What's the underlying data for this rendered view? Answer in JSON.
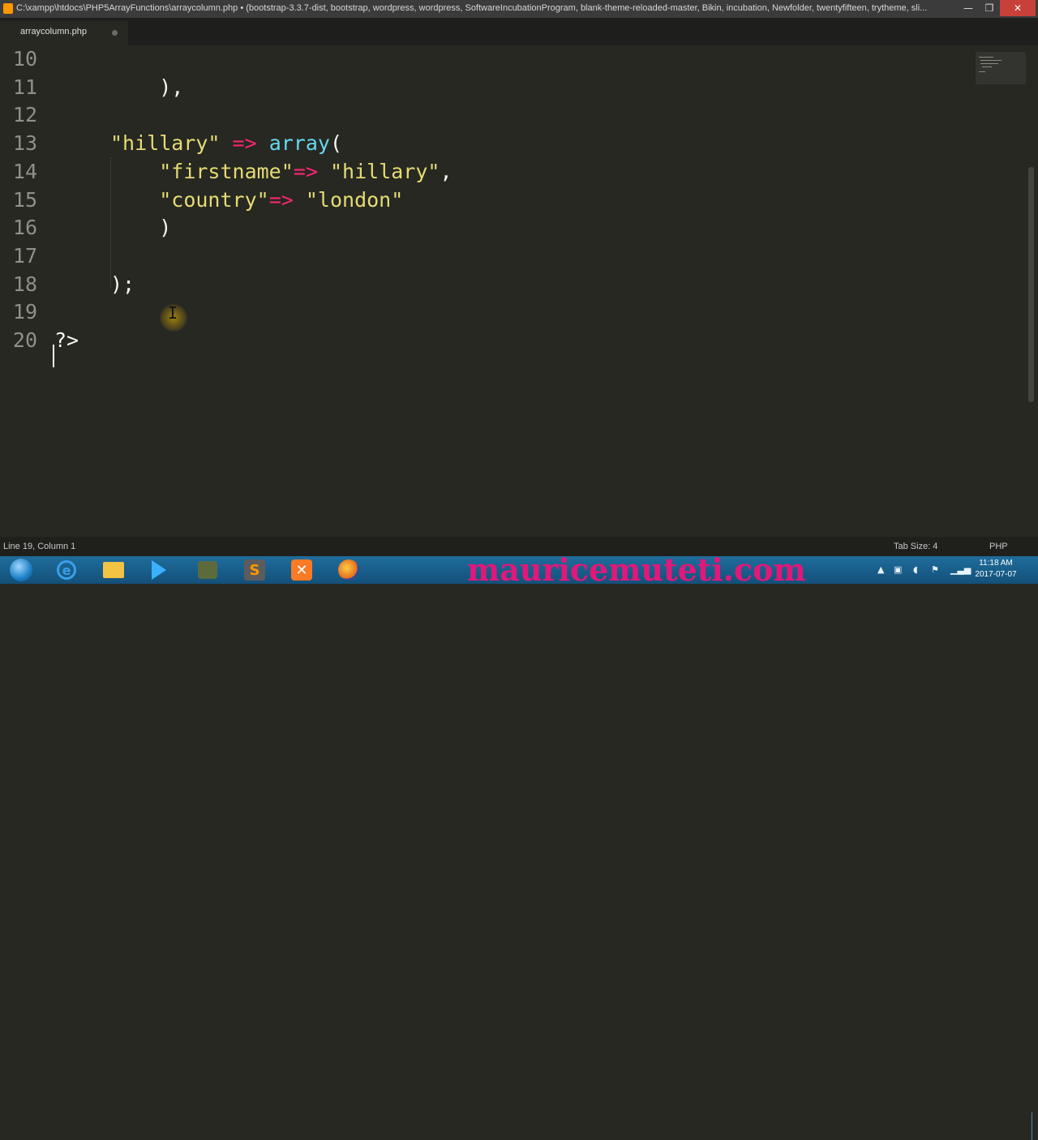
{
  "window": {
    "title": "C:\\xampp\\htdocs\\PHP5ArrayFunctions\\arraycolumn.php • (bootstrap-3.3.7-dist, bootstrap, wordpress, wordpress, SoftwareIncubationProgram, blank-theme-reloaded-master, Bikin, incubation, Newfolder, twentyfifteen, trytheme, sli...",
    "minimize_glyph": "—",
    "maximize_glyph": "❐",
    "close_glyph": "✕"
  },
  "tabs": [
    {
      "label": "arraycolumn.php",
      "dirty": true
    }
  ],
  "editor": {
    "lines": [
      {
        "number": "10",
        "segments": []
      },
      {
        "number": "11",
        "segments": [
          {
            "t": "    ),",
            "c": "plain"
          }
        ]
      },
      {
        "number": "12",
        "segments": []
      },
      {
        "number": "13",
        "segments": [
          {
            "t": "\"hillary\"",
            "c": "str"
          },
          {
            "t": " ",
            "c": "plain"
          },
          {
            "t": "=>",
            "c": "op"
          },
          {
            "t": " ",
            "c": "plain"
          },
          {
            "t": "array",
            "c": "fn"
          },
          {
            "t": "(",
            "c": "plain"
          }
        ]
      },
      {
        "number": "14",
        "segments": [
          {
            "t": "    ",
            "c": "plain"
          },
          {
            "t": "\"firstname\"",
            "c": "str"
          },
          {
            "t": "=>",
            "c": "op"
          },
          {
            "t": " ",
            "c": "plain"
          },
          {
            "t": "\"hillary\"",
            "c": "str"
          },
          {
            "t": ",",
            "c": "plain"
          }
        ]
      },
      {
        "number": "15",
        "segments": [
          {
            "t": "    ",
            "c": "plain"
          },
          {
            "t": "\"country\"",
            "c": "str"
          },
          {
            "t": "=>",
            "c": "op"
          },
          {
            "t": " ",
            "c": "plain"
          },
          {
            "t": "\"london\"",
            "c": "str"
          }
        ]
      },
      {
        "number": "16",
        "segments": [
          {
            "t": "    )",
            "c": "plain"
          }
        ]
      },
      {
        "number": "17",
        "segments": []
      },
      {
        "number": "18",
        "segments": [
          {
            "t": ");",
            "c": "plain"
          }
        ]
      },
      {
        "number": "19",
        "segments": []
      },
      {
        "number": "20",
        "segments": [
          {
            "t": "?>",
            "c": "plain"
          }
        ]
      }
    ],
    "cursor_line": "19"
  },
  "status": {
    "position": "Line 19, Column 1",
    "tab_size": "Tab Size: 4",
    "syntax": "PHP"
  },
  "taskbar": {
    "watermark": "mauricemuteti.com",
    "tray_expand_glyph": "▲",
    "time": "11:18 AM",
    "date": "2017-07-07"
  },
  "colors": {
    "background": "#272822",
    "string": "#e6db74",
    "operator": "#f92672",
    "function": "#66d9ef",
    "line_number": "#8f908a",
    "watermark": "#e3177a"
  }
}
